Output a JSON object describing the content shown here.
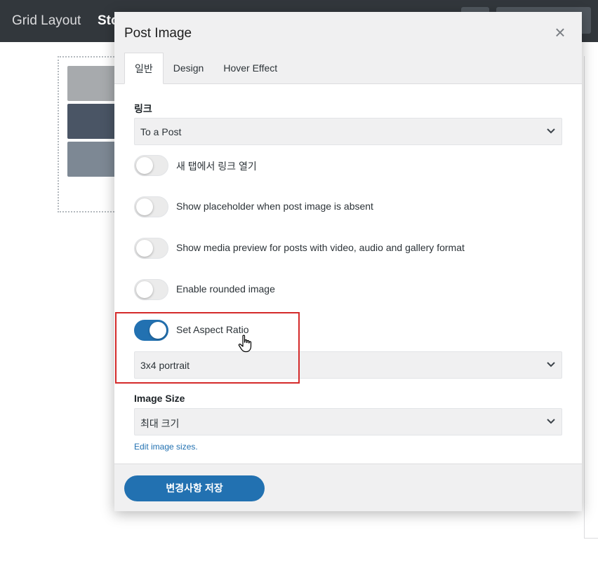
{
  "topbar": {
    "app_title": "Grid Layout",
    "section_title": "Sto"
  },
  "modal": {
    "title": "Post Image",
    "close_icon": "close-icon",
    "tabs": [
      {
        "label": "일반",
        "active": true
      },
      {
        "label": "Design",
        "active": false
      },
      {
        "label": "Hover Effect",
        "active": false
      }
    ],
    "link": {
      "label": "링크",
      "selected": "To a Post"
    },
    "toggles": [
      {
        "label": "새 탭에서 링크 열기",
        "on": false
      },
      {
        "label": "Show placeholder when post image is absent",
        "on": false
      },
      {
        "label": "Show media preview for posts with video, audio and gallery format",
        "on": false
      },
      {
        "label": "Enable rounded image",
        "on": false
      },
      {
        "label": "Set Aspect Ratio",
        "on": true
      }
    ],
    "aspect_ratio": {
      "selected": "3x4 portrait"
    },
    "image_size": {
      "label": "Image Size",
      "selected": "최대 크기",
      "edit_link": "Edit image sizes."
    },
    "footer": {
      "save_label": "변경사항 저장"
    }
  },
  "colors": {
    "accent": "#2271b1",
    "topbar": "#32373c",
    "highlight": "#d42a2a"
  }
}
